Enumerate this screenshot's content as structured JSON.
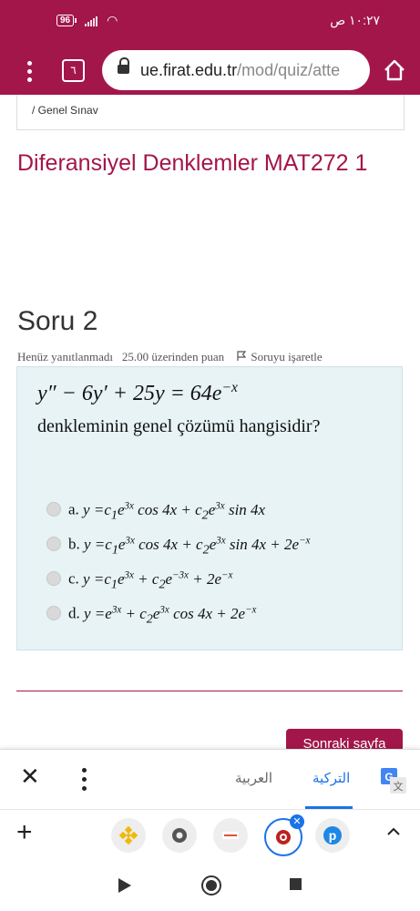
{
  "status": {
    "battery": "96",
    "time": "١٠:٢٧ ص"
  },
  "browser": {
    "tab_count": "٦",
    "url_host": "ue.firat.edu.tr",
    "url_path": "/mod/quiz/atte"
  },
  "breadcrumb": "/ Genel Sınav",
  "course_title": "Diferansiyel Denklemler MAT272 1",
  "question": {
    "heading": "Soru 2",
    "status": "Henüz yanıtlanmadı",
    "points": "25.00 üzerinden puan",
    "flag_label": "Soruyu işaretle",
    "text": "denkleminin genel çözümü hangisidir?",
    "answers": [
      {
        "letter": "a."
      },
      {
        "letter": "b."
      },
      {
        "letter": "c."
      },
      {
        "letter": "d."
      }
    ]
  },
  "next_button": "Sonraki sayfa",
  "translate": {
    "lang_arabic": "العربية",
    "lang_turkish": "التركية"
  },
  "colors": {
    "brand": "#a3164a",
    "question_bg": "#e7f3f5",
    "google_blue": "#1a73e8"
  }
}
